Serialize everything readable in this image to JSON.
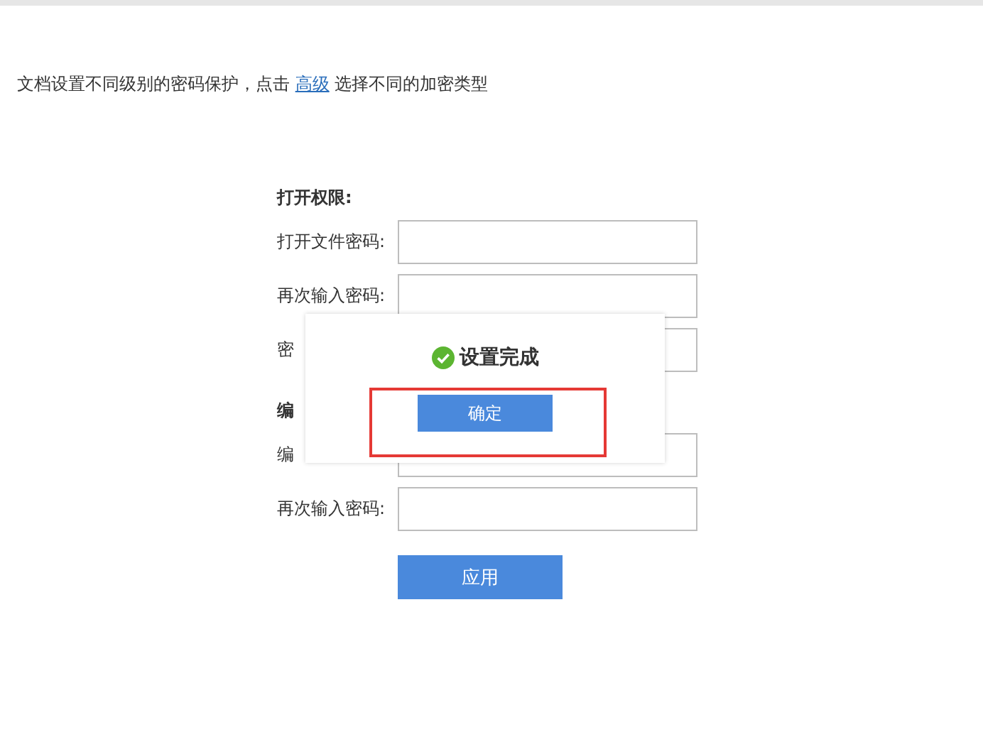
{
  "intro": {
    "text": "文档设置不同级别的密码保护，点击",
    "link": "高级",
    "after": "选择不同的加密类型"
  },
  "sections": [
    {
      "heading": "打开权限:",
      "fields": [
        {
          "label": "打开文件密码:"
        },
        {
          "label": "再次输入密码:"
        },
        {
          "label": "密"
        }
      ]
    },
    {
      "heading": "编",
      "fields": [
        {
          "label": "编"
        },
        {
          "label": "再次输入密码:"
        }
      ]
    }
  ],
  "apply_button": "应用",
  "dialog": {
    "message": "设置完成",
    "button": "确定",
    "highlighted": true
  }
}
